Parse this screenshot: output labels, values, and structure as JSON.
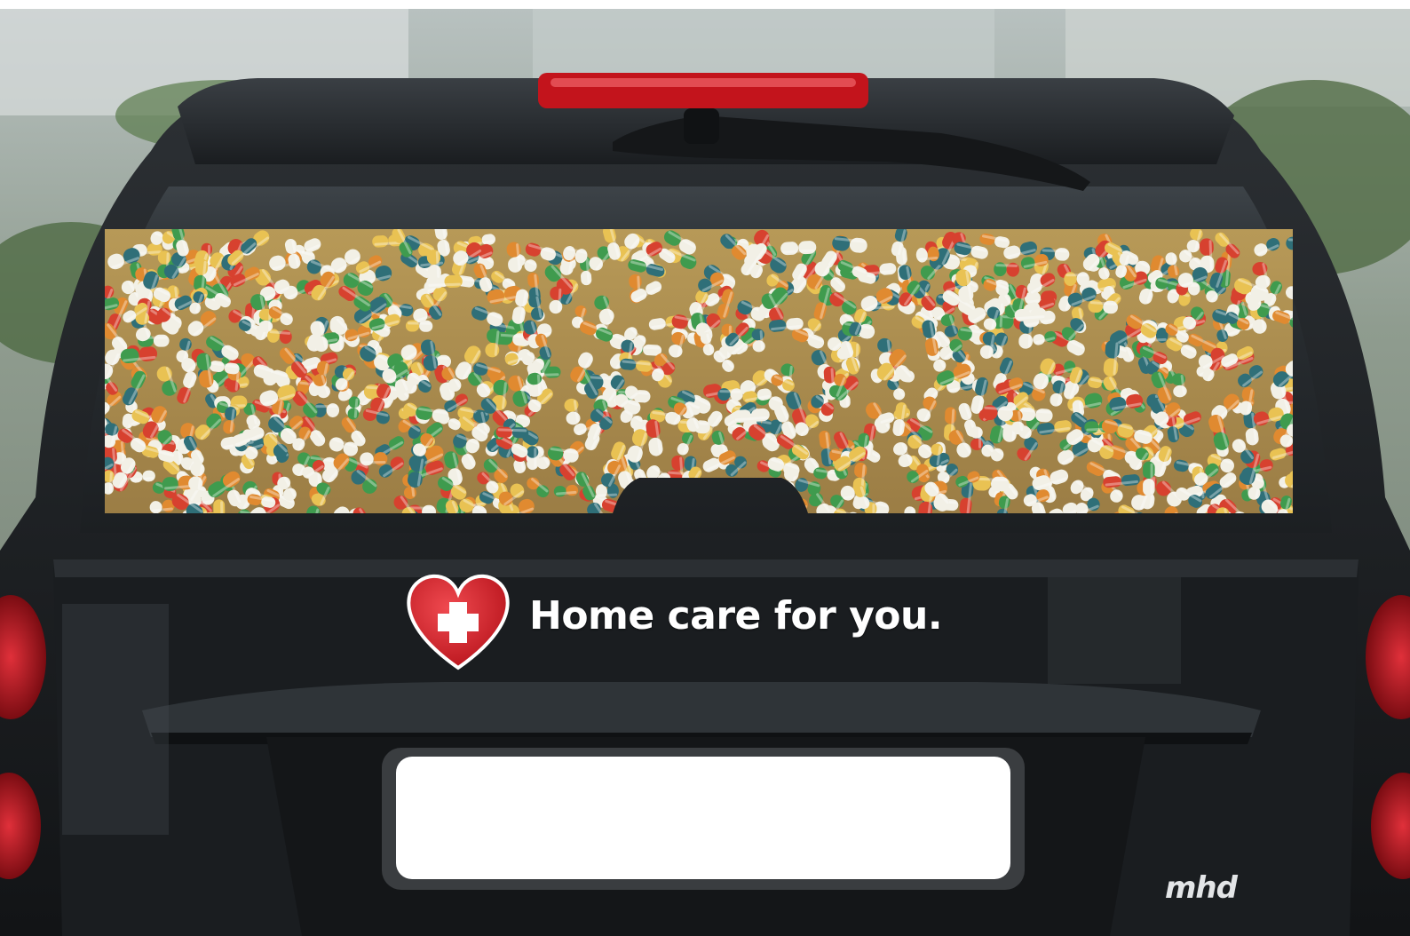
{
  "decal": {
    "slogan": "Home care for you.",
    "logo_icon": "heart-with-cross-icon",
    "heart_color": "#d8202a",
    "cross_color": "#ffffff"
  },
  "vehicle": {
    "brand_badge": "mhd",
    "body_color": "#1e2124"
  },
  "pill_colors": [
    "#f2f0e6",
    "#e9c253",
    "#d7412f",
    "#2f6f78",
    "#3f9b4e",
    "#e08a30"
  ]
}
